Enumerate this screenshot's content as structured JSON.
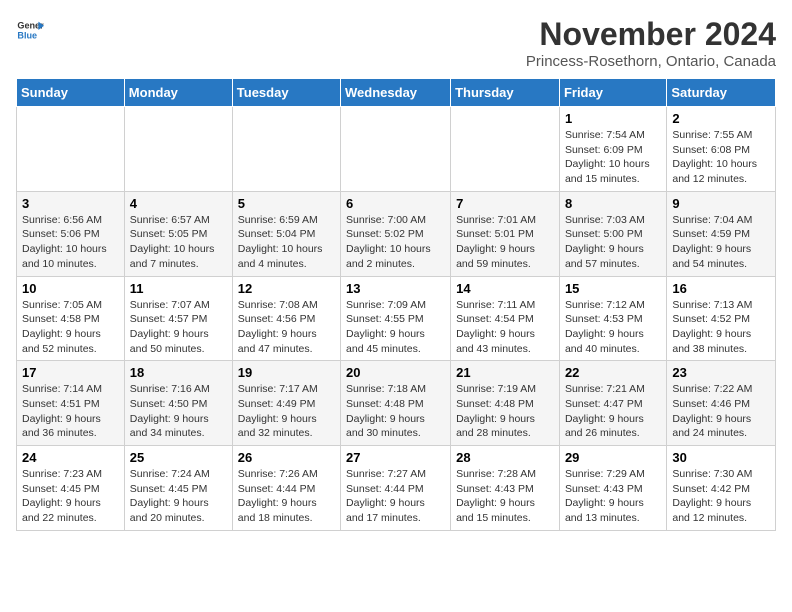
{
  "header": {
    "logo_line1": "General",
    "logo_line2": "Blue",
    "month_title": "November 2024",
    "location": "Princess-Rosethorn, Ontario, Canada"
  },
  "days_of_week": [
    "Sunday",
    "Monday",
    "Tuesday",
    "Wednesday",
    "Thursday",
    "Friday",
    "Saturday"
  ],
  "weeks": [
    [
      {
        "day": "",
        "info": ""
      },
      {
        "day": "",
        "info": ""
      },
      {
        "day": "",
        "info": ""
      },
      {
        "day": "",
        "info": ""
      },
      {
        "day": "",
        "info": ""
      },
      {
        "day": "1",
        "info": "Sunrise: 7:54 AM\nSunset: 6:09 PM\nDaylight: 10 hours and 15 minutes."
      },
      {
        "day": "2",
        "info": "Sunrise: 7:55 AM\nSunset: 6:08 PM\nDaylight: 10 hours and 12 minutes."
      }
    ],
    [
      {
        "day": "3",
        "info": "Sunrise: 6:56 AM\nSunset: 5:06 PM\nDaylight: 10 hours and 10 minutes."
      },
      {
        "day": "4",
        "info": "Sunrise: 6:57 AM\nSunset: 5:05 PM\nDaylight: 10 hours and 7 minutes."
      },
      {
        "day": "5",
        "info": "Sunrise: 6:59 AM\nSunset: 5:04 PM\nDaylight: 10 hours and 4 minutes."
      },
      {
        "day": "6",
        "info": "Sunrise: 7:00 AM\nSunset: 5:02 PM\nDaylight: 10 hours and 2 minutes."
      },
      {
        "day": "7",
        "info": "Sunrise: 7:01 AM\nSunset: 5:01 PM\nDaylight: 9 hours and 59 minutes."
      },
      {
        "day": "8",
        "info": "Sunrise: 7:03 AM\nSunset: 5:00 PM\nDaylight: 9 hours and 57 minutes."
      },
      {
        "day": "9",
        "info": "Sunrise: 7:04 AM\nSunset: 4:59 PM\nDaylight: 9 hours and 54 minutes."
      }
    ],
    [
      {
        "day": "10",
        "info": "Sunrise: 7:05 AM\nSunset: 4:58 PM\nDaylight: 9 hours and 52 minutes."
      },
      {
        "day": "11",
        "info": "Sunrise: 7:07 AM\nSunset: 4:57 PM\nDaylight: 9 hours and 50 minutes."
      },
      {
        "day": "12",
        "info": "Sunrise: 7:08 AM\nSunset: 4:56 PM\nDaylight: 9 hours and 47 minutes."
      },
      {
        "day": "13",
        "info": "Sunrise: 7:09 AM\nSunset: 4:55 PM\nDaylight: 9 hours and 45 minutes."
      },
      {
        "day": "14",
        "info": "Sunrise: 7:11 AM\nSunset: 4:54 PM\nDaylight: 9 hours and 43 minutes."
      },
      {
        "day": "15",
        "info": "Sunrise: 7:12 AM\nSunset: 4:53 PM\nDaylight: 9 hours and 40 minutes."
      },
      {
        "day": "16",
        "info": "Sunrise: 7:13 AM\nSunset: 4:52 PM\nDaylight: 9 hours and 38 minutes."
      }
    ],
    [
      {
        "day": "17",
        "info": "Sunrise: 7:14 AM\nSunset: 4:51 PM\nDaylight: 9 hours and 36 minutes."
      },
      {
        "day": "18",
        "info": "Sunrise: 7:16 AM\nSunset: 4:50 PM\nDaylight: 9 hours and 34 minutes."
      },
      {
        "day": "19",
        "info": "Sunrise: 7:17 AM\nSunset: 4:49 PM\nDaylight: 9 hours and 32 minutes."
      },
      {
        "day": "20",
        "info": "Sunrise: 7:18 AM\nSunset: 4:48 PM\nDaylight: 9 hours and 30 minutes."
      },
      {
        "day": "21",
        "info": "Sunrise: 7:19 AM\nSunset: 4:48 PM\nDaylight: 9 hours and 28 minutes."
      },
      {
        "day": "22",
        "info": "Sunrise: 7:21 AM\nSunset: 4:47 PM\nDaylight: 9 hours and 26 minutes."
      },
      {
        "day": "23",
        "info": "Sunrise: 7:22 AM\nSunset: 4:46 PM\nDaylight: 9 hours and 24 minutes."
      }
    ],
    [
      {
        "day": "24",
        "info": "Sunrise: 7:23 AM\nSunset: 4:45 PM\nDaylight: 9 hours and 22 minutes."
      },
      {
        "day": "25",
        "info": "Sunrise: 7:24 AM\nSunset: 4:45 PM\nDaylight: 9 hours and 20 minutes."
      },
      {
        "day": "26",
        "info": "Sunrise: 7:26 AM\nSunset: 4:44 PM\nDaylight: 9 hours and 18 minutes."
      },
      {
        "day": "27",
        "info": "Sunrise: 7:27 AM\nSunset: 4:44 PM\nDaylight: 9 hours and 17 minutes."
      },
      {
        "day": "28",
        "info": "Sunrise: 7:28 AM\nSunset: 4:43 PM\nDaylight: 9 hours and 15 minutes."
      },
      {
        "day": "29",
        "info": "Sunrise: 7:29 AM\nSunset: 4:43 PM\nDaylight: 9 hours and 13 minutes."
      },
      {
        "day": "30",
        "info": "Sunrise: 7:30 AM\nSunset: 4:42 PM\nDaylight: 9 hours and 12 minutes."
      }
    ]
  ]
}
